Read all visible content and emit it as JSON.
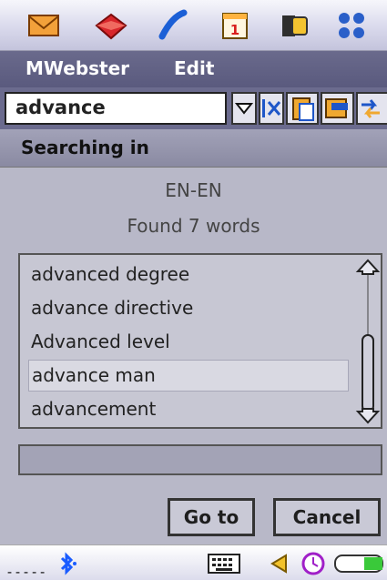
{
  "menubar": {
    "app_menu": "MWebster",
    "edit_menu": "Edit"
  },
  "search": {
    "value": "advance"
  },
  "status": {
    "heading": "Searching in",
    "dictionary": "EN-EN",
    "result_count": "Found 7 words"
  },
  "results": [
    "advanced degree",
    "advance directive",
    "Advanced level",
    "advance man",
    "advancement"
  ],
  "selected_index": 3,
  "buttons": {
    "goto_label": "Go to",
    "cancel_label": "Cancel"
  },
  "statusbar": {
    "signal_text": "-----"
  },
  "icons": {
    "topbar": [
      "mail-icon",
      "gem-icon",
      "phone-icon",
      "calendar-icon",
      "contacts-icon",
      "menu-grid-icon"
    ],
    "toolbar": [
      "dropdown-icon",
      "clear-icon",
      "paste-icon",
      "copy-icon",
      "swap-icon"
    ],
    "statusbar": [
      "bluetooth-icon",
      "keyboard-icon",
      "speaker-icon",
      "clock-icon",
      "battery-icon"
    ]
  },
  "colors": {
    "accent": "#1a5cff",
    "menubar": "#5a5a7e",
    "list_bg": "#c7c7d3"
  }
}
